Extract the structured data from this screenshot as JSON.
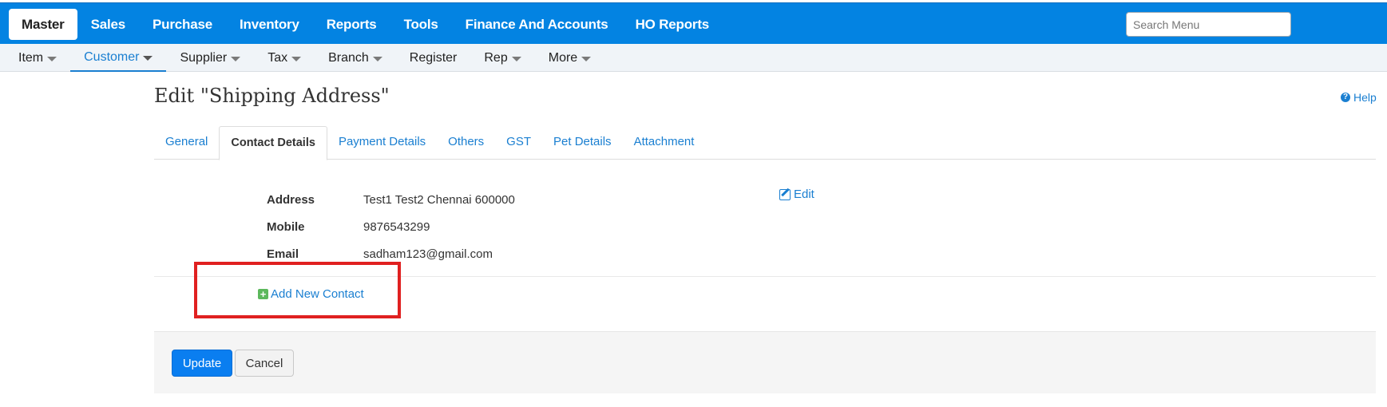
{
  "top_nav": {
    "items": [
      {
        "label": "Master",
        "active": true
      },
      {
        "label": "Sales"
      },
      {
        "label": "Purchase"
      },
      {
        "label": "Inventory"
      },
      {
        "label": "Reports"
      },
      {
        "label": "Tools"
      },
      {
        "label": "Finance And Accounts"
      },
      {
        "label": "HO Reports"
      }
    ],
    "search_placeholder": "Search Menu",
    "bar_color": "#0383e2"
  },
  "sub_nav": {
    "items": [
      {
        "label": "Item",
        "dropdown": true
      },
      {
        "label": "Customer",
        "dropdown": true,
        "active": true
      },
      {
        "label": "Supplier",
        "dropdown": true
      },
      {
        "label": "Tax",
        "dropdown": true
      },
      {
        "label": "Branch",
        "dropdown": true
      },
      {
        "label": "Register",
        "dropdown": false
      },
      {
        "label": "Rep",
        "dropdown": true
      },
      {
        "label": "More",
        "dropdown": true
      }
    ]
  },
  "page": {
    "title": "Edit \"Shipping Address\"",
    "help_label": "Help"
  },
  "tabs": [
    {
      "label": "General"
    },
    {
      "label": "Contact Details",
      "active": true
    },
    {
      "label": "Payment Details"
    },
    {
      "label": "Others"
    },
    {
      "label": "GST"
    },
    {
      "label": "Pet Details"
    },
    {
      "label": "Attachment"
    }
  ],
  "contact": {
    "address_label": "Address",
    "address_value": "Test1 Test2 Chennai 600000",
    "mobile_label": "Mobile",
    "mobile_value": "9876543299",
    "email_label": "Email",
    "email_value": "sadham123@gmail.com",
    "edit_label": "Edit"
  },
  "add_contact_label": "Add New Contact",
  "buttons": {
    "update_label": "Update",
    "cancel_label": "Cancel"
  },
  "colors": {
    "accent": "#1a7fd1",
    "primary_button": "#0a7ef0",
    "add_icon": "#5cb85c",
    "highlight": "#e02020"
  }
}
